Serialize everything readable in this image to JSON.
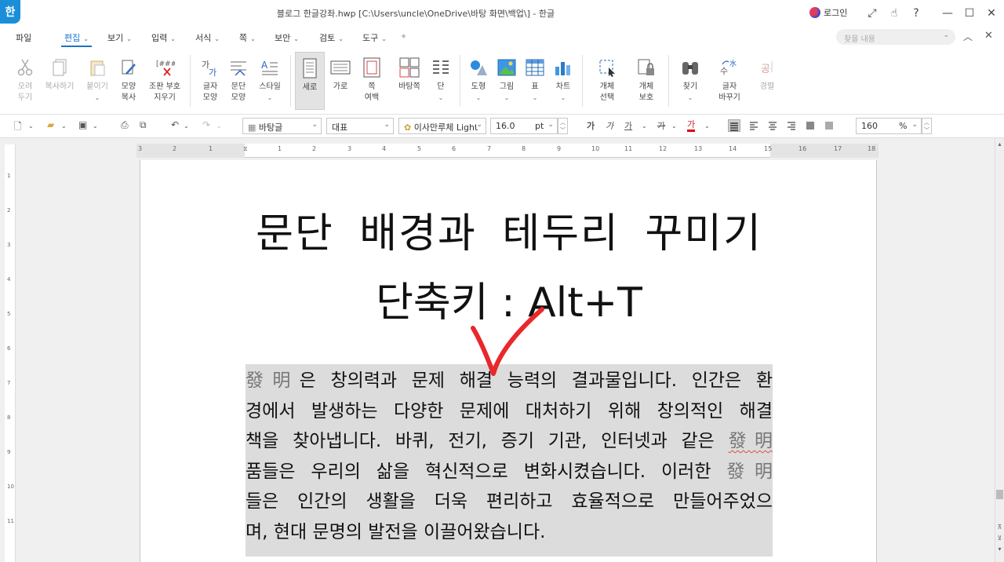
{
  "app": {
    "logo": "한",
    "title": "블로그 한글강좌.hwp [C:\\Users\\uncle\\OneDrive\\바탕 화면\\백업\\] - 한글",
    "login": "로그인"
  },
  "window_icons": [
    "expand-icon",
    "hand-icon",
    "help-icon",
    "minimize-icon",
    "maximize-icon",
    "close-icon"
  ],
  "menu": {
    "items": [
      "파일",
      "편집",
      "보기",
      "입력",
      "서식",
      "쪽",
      "보안",
      "검토",
      "도구"
    ],
    "active": "편집",
    "search_placeholder": "찾을 내용"
  },
  "ribbon": {
    "cut": [
      "오려",
      "두기"
    ],
    "copy": "복사하기",
    "paste": "붙이기",
    "shape_copy": [
      "모양",
      "복사"
    ],
    "clear_code": [
      "조판 부호",
      "지우기"
    ],
    "char_shape": [
      "글자",
      "모양"
    ],
    "para_shape": [
      "문단",
      "모양"
    ],
    "style": "스타일",
    "portrait": "세로",
    "landscape": "가로",
    "page_margin": [
      "쪽",
      "여백"
    ],
    "master_page": "바탕쪽",
    "column": "단",
    "shape": "도형",
    "picture": "그림",
    "table": "표",
    "chart": "차트",
    "select_object": [
      "개체",
      "선택"
    ],
    "protect_object": [
      "개체",
      "보호"
    ],
    "find": "찾기",
    "replace_char": [
      "글자",
      "바꾸기"
    ],
    "warning": "경렬"
  },
  "format_bar": {
    "style": "바탕글",
    "lang": "대표",
    "font": "이사만루체 Light",
    "font_size": "16.0",
    "unit": "pt",
    "zoom": "160",
    "zoom_unit": "%"
  },
  "ruler_numbers": [
    "3",
    "2",
    "1",
    "1",
    "2",
    "3",
    "4",
    "5",
    "6",
    "7",
    "8",
    "9",
    "10",
    "11",
    "12",
    "13",
    "14",
    "15",
    "16",
    "17",
    "18"
  ],
  "vruler_numbers": [
    "1",
    "2",
    "3",
    "4",
    "5",
    "6",
    "7",
    "8",
    "9",
    "10",
    "11"
  ],
  "document": {
    "title": "문단 배경과 테두리 꾸미기",
    "subtitle": "단축키 : Alt+T",
    "paragraph": [
      {
        "hanja": "發明",
        "text": "은 창의력과 문제 해결 능력의 결과물입니다. 인간은 환"
      },
      {
        "text": "경에서 발생하는 다양한 문제에 대처하기 위해 창의적인 해결"
      },
      {
        "text": "책을 찾아냅니다. 바퀴, 전기, 증기 기관, 인터넷과 같은 ",
        "hanja_after": "發明"
      },
      {
        "text": "품들은 우리의 삶을 혁신적으로 변화시켰습니다. 이러한 ",
        "hanja_after": "發明"
      },
      {
        "text": "들은 인간의 생활을 더욱 편리하고 효율적으로 만들어주었으"
      },
      {
        "text": "며, 현대 문명의 발전을 이끌어왔습니다."
      }
    ]
  }
}
